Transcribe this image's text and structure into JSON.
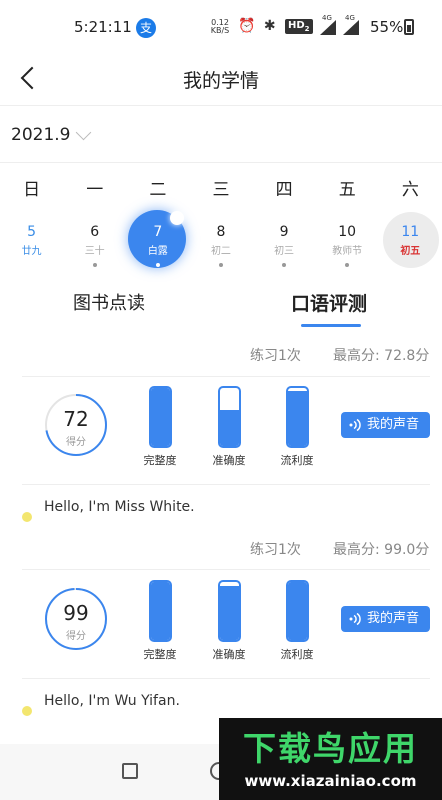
{
  "status_bar": {
    "time": "5:21:11",
    "app_icon_glyph": "支",
    "net_speed": "0.12 KB/S",
    "hd": "HD",
    "hd_sub": "2",
    "net1": "4G",
    "net2": "4G",
    "battery": "55%"
  },
  "header": {
    "title": "我的学情"
  },
  "month": {
    "label": "2021.9"
  },
  "weekdays": [
    "日",
    "一",
    "二",
    "三",
    "四",
    "五",
    "六"
  ],
  "dates": [
    {
      "num": "5",
      "sub": "廿九",
      "dot": false,
      "state": "sunday"
    },
    {
      "num": "6",
      "sub": "三十",
      "dot": true,
      "state": ""
    },
    {
      "num": "7",
      "sub": "白露",
      "dot": true,
      "state": "selected"
    },
    {
      "num": "8",
      "sub": "初二",
      "dot": true,
      "state": ""
    },
    {
      "num": "9",
      "sub": "初三",
      "dot": true,
      "state": ""
    },
    {
      "num": "10",
      "sub": "教师节",
      "dot": true,
      "state": ""
    },
    {
      "num": "11",
      "sub": "初五",
      "dot": false,
      "state": "today"
    }
  ],
  "tabs": {
    "books": "图书点读",
    "oral": "口语评测"
  },
  "records": [
    {
      "practice": "练习1次",
      "best": "最高分: 72.8分",
      "score": "72",
      "score_label": "得分",
      "score_pct": 0.72,
      "metrics": [
        {
          "label": "完整度",
          "level": 1.0
        },
        {
          "label": "准确度",
          "level": 0.62
        },
        {
          "label": "流利度",
          "level": 0.95
        }
      ],
      "voice_label": "我的声音",
      "sentence": "Hello, I'm Miss White."
    },
    {
      "practice": "练习1次",
      "best": "最高分: 99.0分",
      "score": "99",
      "score_label": "得分",
      "score_pct": 0.99,
      "metrics": [
        {
          "label": "完整度",
          "level": 1.0
        },
        {
          "label": "准确度",
          "level": 0.93
        },
        {
          "label": "流利度",
          "level": 1.0
        }
      ],
      "voice_label": "我的声音",
      "sentence": "Hello, I'm Wu Yifan."
    }
  ],
  "watermark": {
    "title": "下载鸟应用",
    "url": "www.xiazainiao.com"
  },
  "colors": {
    "accent": "#3b86ee",
    "highlight_red": "#d93434",
    "dot_yellow": "#f3e66f"
  },
  "icons": {
    "back": "back-arrow-icon",
    "chevron": "chevron-down-icon",
    "voice": "speaker-icon"
  }
}
